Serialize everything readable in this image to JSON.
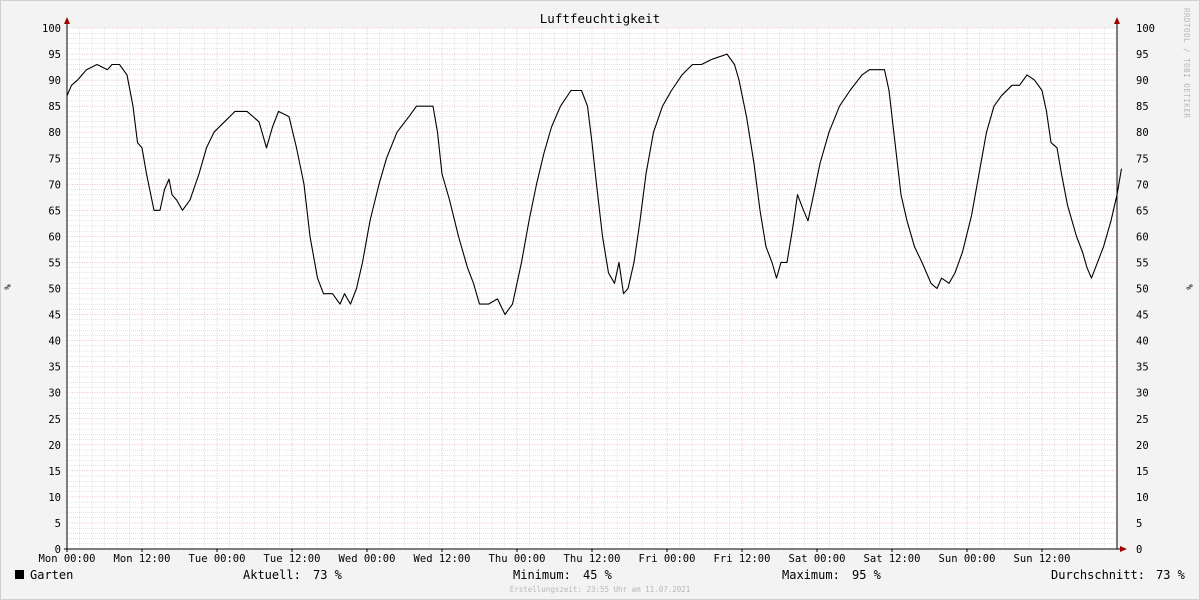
{
  "chart_data": {
    "type": "line",
    "title": "Luftfeuchtigkeit",
    "ylabel": "%",
    "ylim": [
      0,
      100
    ],
    "yticks": [
      0,
      5,
      10,
      15,
      20,
      25,
      30,
      35,
      40,
      45,
      50,
      55,
      60,
      65,
      70,
      75,
      80,
      85,
      90,
      95,
      100
    ],
    "xlim": [
      0,
      7
    ],
    "xunit": "days since Mon 00:00",
    "xticks": [
      {
        "x": 0.0,
        "label": "Mon 00:00"
      },
      {
        "x": 0.5,
        "label": "Mon 12:00"
      },
      {
        "x": 1.0,
        "label": "Tue 00:00"
      },
      {
        "x": 1.5,
        "label": "Tue 12:00"
      },
      {
        "x": 2.0,
        "label": "Wed 00:00"
      },
      {
        "x": 2.5,
        "label": "Wed 12:00"
      },
      {
        "x": 3.0,
        "label": "Thu 00:00"
      },
      {
        "x": 3.5,
        "label": "Thu 12:00"
      },
      {
        "x": 4.0,
        "label": "Fri 00:00"
      },
      {
        "x": 4.5,
        "label": "Fri 12:00"
      },
      {
        "x": 5.0,
        "label": "Sat 00:00"
      },
      {
        "x": 5.5,
        "label": "Sat 12:00"
      },
      {
        "x": 6.0,
        "label": "Sun 00:00"
      },
      {
        "x": 6.5,
        "label": "Sun 12:00"
      }
    ],
    "grid": true,
    "series": [
      {
        "name": "Garten",
        "color": "#000000",
        "points": [
          [
            0.0,
            87
          ],
          [
            0.03,
            89
          ],
          [
            0.07,
            90
          ],
          [
            0.1,
            91
          ],
          [
            0.13,
            92
          ],
          [
            0.2,
            93
          ],
          [
            0.27,
            92
          ],
          [
            0.3,
            93
          ],
          [
            0.35,
            93
          ],
          [
            0.4,
            91
          ],
          [
            0.44,
            85
          ],
          [
            0.47,
            78
          ],
          [
            0.5,
            77
          ],
          [
            0.53,
            72
          ],
          [
            0.58,
            65
          ],
          [
            0.62,
            65
          ],
          [
            0.65,
            69
          ],
          [
            0.68,
            71
          ],
          [
            0.7,
            68
          ],
          [
            0.73,
            67
          ],
          [
            0.77,
            65
          ],
          [
            0.82,
            67
          ],
          [
            0.88,
            72
          ],
          [
            0.93,
            77
          ],
          [
            0.98,
            80
          ],
          [
            1.05,
            82
          ],
          [
            1.12,
            84
          ],
          [
            1.2,
            84
          ],
          [
            1.28,
            82
          ],
          [
            1.33,
            77
          ],
          [
            1.37,
            81
          ],
          [
            1.41,
            84
          ],
          [
            1.48,
            83
          ],
          [
            1.53,
            77
          ],
          [
            1.58,
            70
          ],
          [
            1.62,
            60
          ],
          [
            1.67,
            52
          ],
          [
            1.71,
            49
          ],
          [
            1.77,
            49
          ],
          [
            1.82,
            47
          ],
          [
            1.85,
            49
          ],
          [
            1.89,
            47
          ],
          [
            1.93,
            50
          ],
          [
            1.97,
            55
          ],
          [
            2.02,
            63
          ],
          [
            2.08,
            70
          ],
          [
            2.13,
            75
          ],
          [
            2.2,
            80
          ],
          [
            2.28,
            83
          ],
          [
            2.33,
            85
          ],
          [
            2.44,
            85
          ],
          [
            2.47,
            80
          ],
          [
            2.5,
            72
          ],
          [
            2.55,
            67
          ],
          [
            2.61,
            60
          ],
          [
            2.67,
            54
          ],
          [
            2.71,
            51
          ],
          [
            2.75,
            47
          ],
          [
            2.81,
            47
          ],
          [
            2.87,
            48
          ],
          [
            2.92,
            45
          ],
          [
            2.97,
            47
          ],
          [
            3.03,
            55
          ],
          [
            3.08,
            63
          ],
          [
            3.13,
            70
          ],
          [
            3.18,
            76
          ],
          [
            3.23,
            81
          ],
          [
            3.29,
            85
          ],
          [
            3.36,
            88
          ],
          [
            3.43,
            88
          ],
          [
            3.47,
            85
          ],
          [
            3.5,
            78
          ],
          [
            3.53,
            70
          ],
          [
            3.57,
            60
          ],
          [
            3.61,
            53
          ],
          [
            3.65,
            51
          ],
          [
            3.68,
            55
          ],
          [
            3.71,
            49
          ],
          [
            3.74,
            50
          ],
          [
            3.78,
            55
          ],
          [
            3.82,
            63
          ],
          [
            3.86,
            72
          ],
          [
            3.91,
            80
          ],
          [
            3.97,
            85
          ],
          [
            4.03,
            88
          ],
          [
            4.1,
            91
          ],
          [
            4.17,
            93
          ],
          [
            4.23,
            93
          ],
          [
            4.3,
            94
          ],
          [
            4.4,
            95
          ],
          [
            4.45,
            93
          ],
          [
            4.48,
            90
          ],
          [
            4.53,
            83
          ],
          [
            4.58,
            74
          ],
          [
            4.62,
            65
          ],
          [
            4.66,
            58
          ],
          [
            4.7,
            55
          ],
          [
            4.73,
            52
          ],
          [
            4.76,
            55
          ],
          [
            4.8,
            55
          ],
          [
            4.84,
            62
          ],
          [
            4.87,
            68
          ],
          [
            4.91,
            65
          ],
          [
            4.94,
            63
          ],
          [
            4.97,
            67
          ],
          [
            5.02,
            74
          ],
          [
            5.08,
            80
          ],
          [
            5.15,
            85
          ],
          [
            5.22,
            88
          ],
          [
            5.3,
            91
          ],
          [
            5.35,
            92
          ],
          [
            5.45,
            92
          ],
          [
            5.48,
            88
          ],
          [
            5.52,
            78
          ],
          [
            5.56,
            68
          ],
          [
            5.6,
            63
          ],
          [
            5.65,
            58
          ],
          [
            5.7,
            55
          ],
          [
            5.76,
            51
          ],
          [
            5.8,
            50
          ],
          [
            5.83,
            52
          ],
          [
            5.88,
            51
          ],
          [
            5.92,
            53
          ],
          [
            5.97,
            57
          ],
          [
            6.03,
            64
          ],
          [
            6.08,
            72
          ],
          [
            6.13,
            80
          ],
          [
            6.18,
            85
          ],
          [
            6.23,
            87
          ],
          [
            6.3,
            89
          ],
          [
            6.35,
            89
          ],
          [
            6.4,
            91
          ],
          [
            6.45,
            90
          ],
          [
            6.5,
            88
          ],
          [
            6.53,
            84
          ],
          [
            6.56,
            78
          ],
          [
            6.6,
            77
          ],
          [
            6.63,
            72
          ],
          [
            6.67,
            66
          ],
          [
            6.7,
            63
          ],
          [
            6.73,
            60
          ],
          [
            6.77,
            57
          ],
          [
            6.8,
            54
          ],
          [
            6.83,
            52
          ],
          [
            6.87,
            55
          ],
          [
            6.91,
            58
          ],
          [
            6.96,
            63
          ],
          [
            7.0,
            68
          ],
          [
            7.03,
            73
          ]
        ]
      }
    ]
  },
  "legend": {
    "series_name": "Garten",
    "current_label": "Aktuell:",
    "current_value": "73 %",
    "min_label": "Minimum:",
    "min_value": "45 %",
    "max_label": "Maximum:",
    "max_value": "95 %",
    "avg_label": "Durchschnitt:",
    "avg_value": "73 %"
  },
  "watermark": "RRDTOOL / TOBI OETIKER",
  "footer": "Erstellungszeit: 23:55 Uhr am 11.07.2021",
  "colors": {
    "major_grid": "#e89a9a",
    "minor_grid": "#c8c8c8",
    "axis": "#000000",
    "arrow": "#a00000"
  }
}
